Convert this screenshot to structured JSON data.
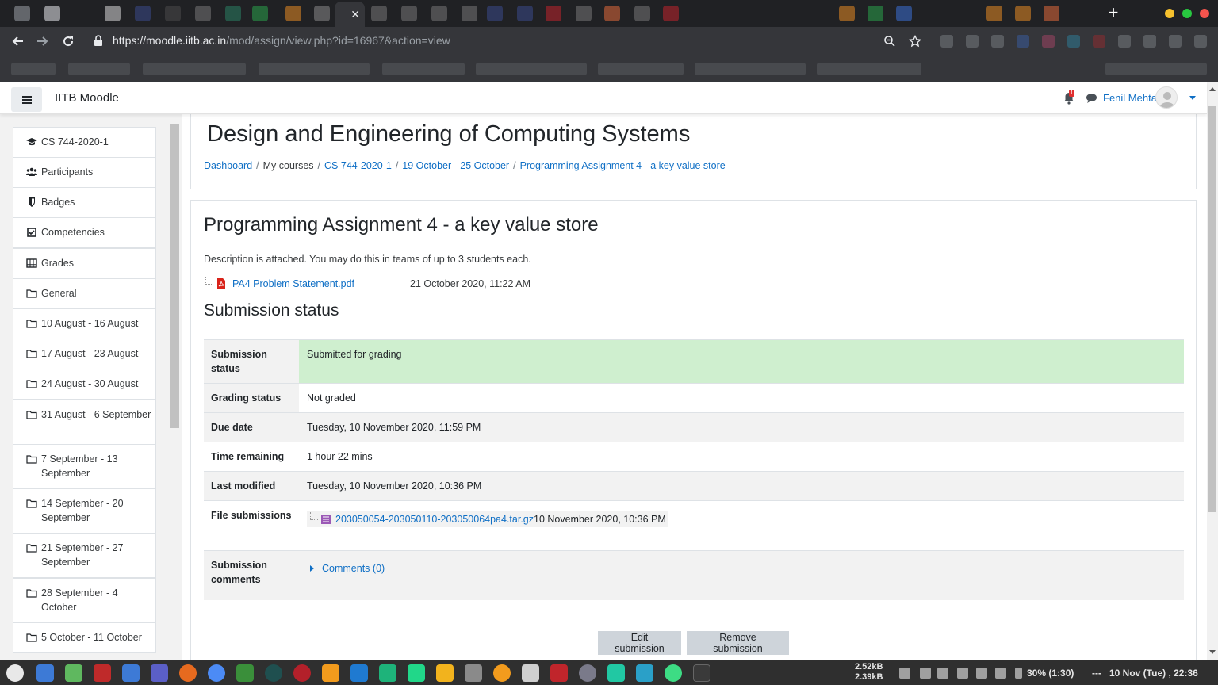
{
  "browser": {
    "url_host": "https://moodle.iitb.ac.in",
    "url_path": "/mod/assign/view.php?id=16967&action=view",
    "new_tab_glyph": "+",
    "close_tab_glyph": "✕",
    "accent_colors": {
      "close": "#f5544d",
      "minimize": "#f6c12e",
      "maximize": "#28c840"
    }
  },
  "navbar": {
    "site_name": "IITB Moodle",
    "notification_count": "1",
    "user_name": "Fenil Mehta"
  },
  "sidebar": {
    "items": [
      {
        "label": "CS 744-2020-1",
        "icon": "graduation-cap-icon"
      },
      {
        "label": "Participants",
        "icon": "users-icon"
      },
      {
        "label": "Badges",
        "icon": "shield-icon"
      },
      {
        "label": "Competencies",
        "icon": "checkbox-icon"
      },
      {
        "label": "Grades",
        "icon": "table-icon"
      },
      {
        "label": "General",
        "icon": "folder-icon"
      },
      {
        "label": "10 August - 16 August",
        "icon": "folder-icon"
      },
      {
        "label": "17 August - 23 August",
        "icon": "folder-icon"
      },
      {
        "label": "24 August - 30 August",
        "icon": "folder-icon"
      },
      {
        "label": "31 August - 6 September",
        "icon": "folder-icon"
      },
      {
        "label": "7 September - 13 September",
        "icon": "folder-icon"
      },
      {
        "label": "14 September - 20 September",
        "icon": "folder-icon"
      },
      {
        "label": "21 September - 27 September",
        "icon": "folder-icon"
      },
      {
        "label": "28 September - 4 October",
        "icon": "folder-icon"
      },
      {
        "label": "5 October - 11 October",
        "icon": "folder-icon"
      }
    ]
  },
  "header": {
    "course_title": "Design and Engineering of Computing Systems",
    "breadcrumb": [
      "Dashboard",
      "My courses",
      "CS 744-2020-1",
      "19 October - 25 October",
      "Programming Assignment 4 - a key value store"
    ],
    "breadcrumb_sep": "/"
  },
  "assignment": {
    "title": "Programming Assignment 4 - a key value store",
    "intro": "Description is attached. You may do this in teams of up to 3 students each.",
    "attachment_name": "PA4 Problem Statement.pdf",
    "attachment_date": "21 October 2020, 11:22 AM",
    "status_heading": "Submission status",
    "status_rows": {
      "submission_status_label": "Submission status",
      "submission_status_value": "Submitted for grading",
      "grading_status_label": "Grading status",
      "grading_status_value": "Not graded",
      "due_date_label": "Due date",
      "due_date_value": "Tuesday, 10 November 2020, 11:59 PM",
      "time_remaining_label": "Time remaining",
      "time_remaining_value": "1 hour 22 mins",
      "last_modified_label": "Last modified",
      "last_modified_value": "Tuesday, 10 November 2020, 10:36 PM",
      "file_submissions_label": "File submissions",
      "file_name": "203050054-203050110-203050064pa4.tar.gz",
      "file_date": "10 November 2020, 10:36 PM",
      "comments_label": "Submission comments",
      "comments_link": "Comments (0)"
    },
    "edit_button": "Edit submission",
    "remove_button": "Remove submission"
  },
  "taskbar": {
    "net_up": "2.52kB",
    "net_down": "2.39kB",
    "battery": "30% (1:30)",
    "separator": "---",
    "clock": "10 Nov (Tue) , 22:36"
  }
}
